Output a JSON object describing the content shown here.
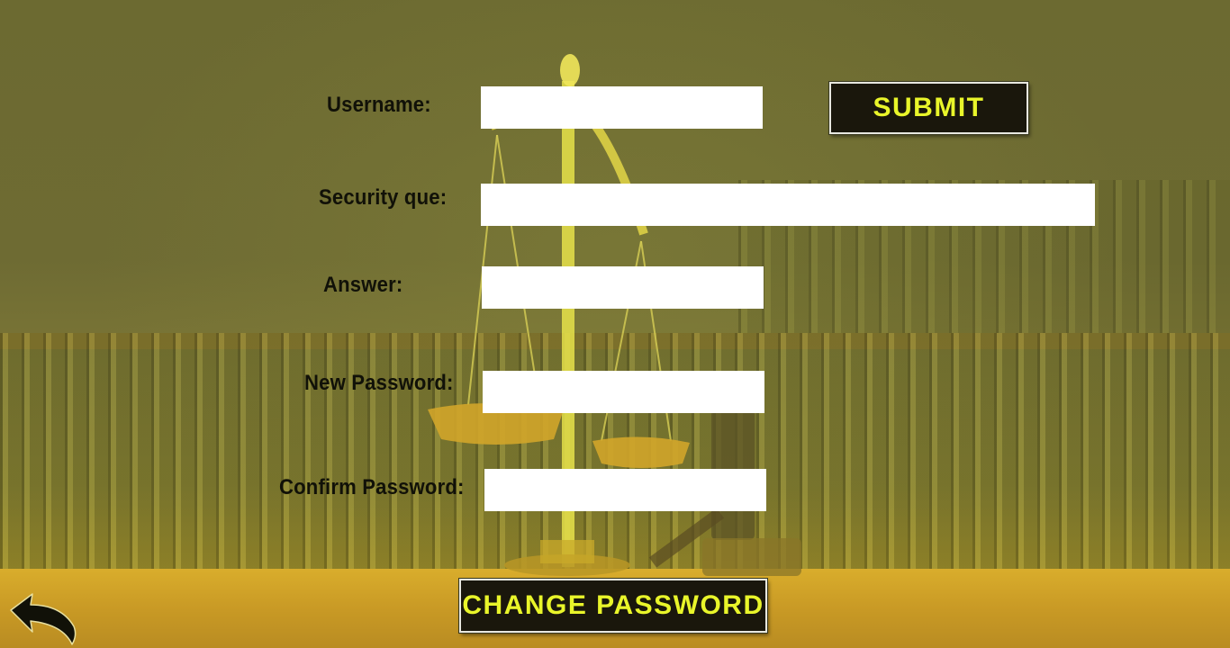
{
  "form": {
    "username_label": "Username:",
    "username_value": "",
    "security_label": "Security que:",
    "security_value": "",
    "answer_label": "Answer:",
    "answer_value": "",
    "new_password_label": "New Password:",
    "new_password_value": "",
    "confirm_password_label": "Confirm Password:",
    "confirm_password_value": ""
  },
  "buttons": {
    "submit_label": "SUBMIT",
    "change_password_label": "CHANGE PASSWORD"
  },
  "icons": {
    "back": "back-arrow-icon",
    "scales": "scales-of-justice-icon",
    "gavel": "gavel-icon"
  },
  "colors": {
    "button_bg": "#1a170c",
    "button_text": "#e9f52a",
    "background_tint": "#6b7033",
    "desk": "#d9ad2c"
  }
}
